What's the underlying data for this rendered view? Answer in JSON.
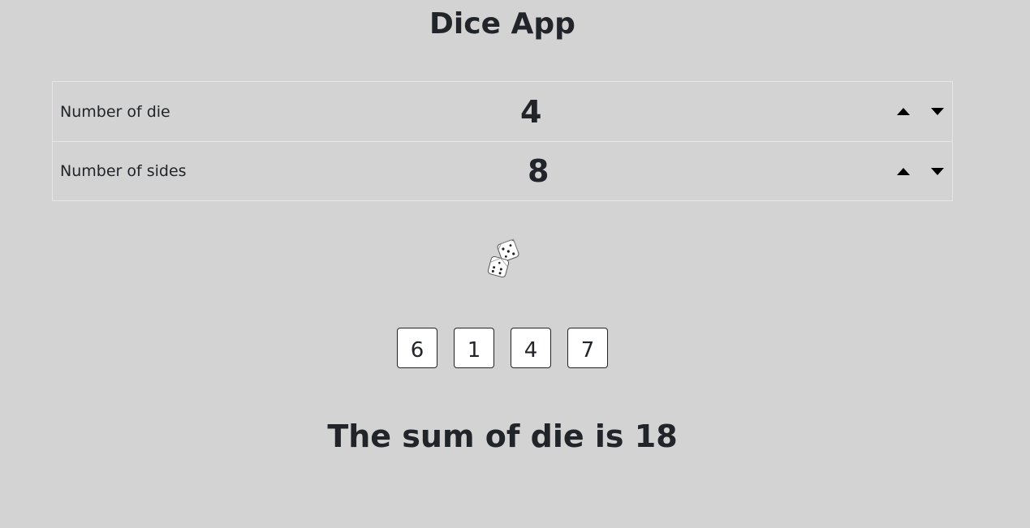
{
  "app": {
    "title": "Dice App"
  },
  "settings": {
    "die": {
      "label": "Number of die",
      "value": "4"
    },
    "sides": {
      "label": "Number of sides",
      "value": "8"
    }
  },
  "icons": {
    "increment": "caret-up-icon",
    "decrement": "caret-down-icon",
    "roll": "dice-icon"
  },
  "results": [
    "6",
    "1",
    "4",
    "7"
  ],
  "sum": {
    "text": "The sum of die is 18"
  }
}
